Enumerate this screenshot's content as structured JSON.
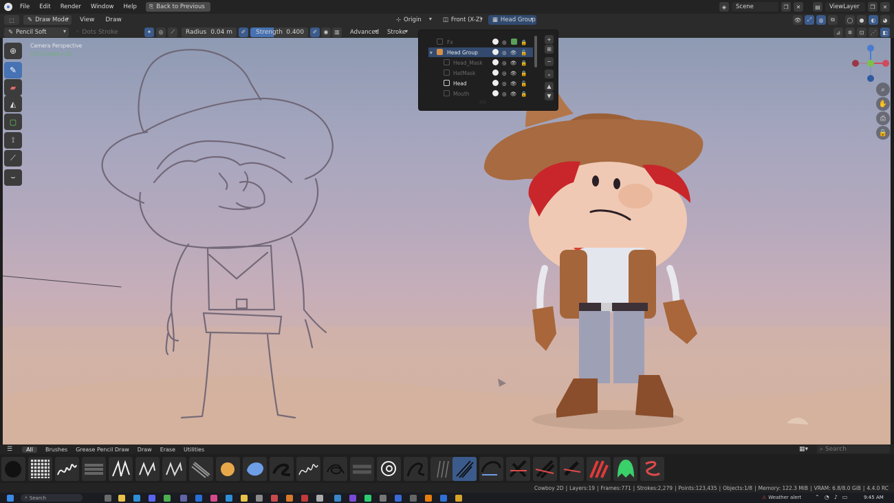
{
  "menu": {
    "items": [
      "File",
      "Edit",
      "Render",
      "Window",
      "Help"
    ],
    "back_label": "Back to Previous",
    "scene": "Scene",
    "view_layer": "ViewLayer"
  },
  "header": {
    "mode": "Draw Mode",
    "view": "View",
    "draw": "Draw",
    "pivot": "Origin",
    "projection": "Front (X-Z)",
    "layer_group": "Head Group"
  },
  "tool_settings": {
    "brush": "Pencil Soft",
    "dots_stroke": "Dots Stroke",
    "radius_label": "Radius",
    "radius_value": "0.04 m",
    "strength_label": "Strength",
    "strength_value": "0.400",
    "advanced": "Advanced",
    "stroke": "Stroke"
  },
  "viewport": {
    "camera": "Camera Perspective",
    "object": "(25) Cowboy 2D"
  },
  "layers": [
    {
      "name": "Fx",
      "dim": true,
      "group": false
    },
    {
      "name": "Head Group",
      "dim": false,
      "group": true
    },
    {
      "name": "Head_Mask",
      "dim": true,
      "group": false
    },
    {
      "name": "HatMask",
      "dim": true,
      "group": false
    },
    {
      "name": "Head",
      "dim": false,
      "group": false
    },
    {
      "name": "Mouth",
      "dim": true,
      "group": false
    }
  ],
  "asset_tabs": [
    "All",
    "Brushes",
    "Grease Pencil Draw",
    "Draw",
    "Erase",
    "Utilities"
  ],
  "asset_search": "Search",
  "status": {
    "object": "Cowboy 2D",
    "layers": "Layers:19",
    "frames": "Frames:771",
    "strokes": "Strokes:2,279",
    "points": "Points:123,435",
    "objects": "Objects:1/8",
    "memory": "Memory: 122.3 MiB",
    "vram": "VRAM: 6.8/8.0 GiB",
    "version": "4.4.0 RC"
  },
  "taskbar": {
    "search": "Search",
    "weather": "Weather alert",
    "time": "9:45 AM"
  },
  "colors": {
    "accent": "#4772b3",
    "selection": "#334a6e",
    "hat": "#a86a40",
    "hair": "#c8262a",
    "bandana": "#d8402e"
  }
}
